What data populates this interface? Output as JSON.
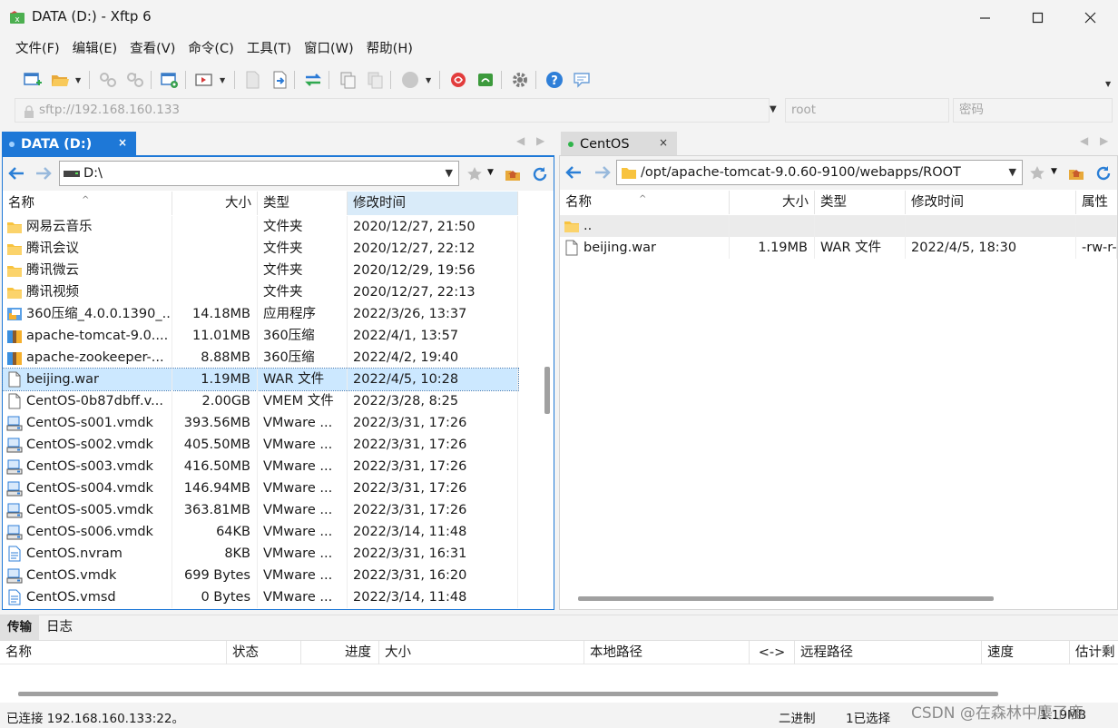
{
  "window": {
    "title": "DATA (D:) - Xftp 6"
  },
  "menu": [
    "文件(F)",
    "编辑(E)",
    "查看(V)",
    "命令(C)",
    "工具(T)",
    "窗口(W)",
    "帮助(H)"
  ],
  "address": {
    "host_placeholder": "sftp://192.168.160.133",
    "user_placeholder": "root",
    "password_placeholder": "密码"
  },
  "colors": {
    "accent": "#1e78d7",
    "local_dot": "#9fd0ff",
    "remote_dot": "#2fb44a",
    "folder": "#f8c33e",
    "selection": "#cce8ff"
  },
  "local": {
    "tab_label": "DATA (D:)",
    "tab_close": "×",
    "path": "D:\\",
    "columns": {
      "name": "名称",
      "size": "大小",
      "type": "类型",
      "modified": "修改时间"
    },
    "files": [
      {
        "name": "网易云音乐",
        "size": "",
        "type": "文件夹",
        "modified": "2020/12/27, 21:50",
        "icon": "folder-icon"
      },
      {
        "name": "腾讯会议",
        "size": "",
        "type": "文件夹",
        "modified": "2020/12/27, 22:12",
        "icon": "folder-icon"
      },
      {
        "name": "腾讯微云",
        "size": "",
        "type": "文件夹",
        "modified": "2020/12/29, 19:56",
        "icon": "folder-icon"
      },
      {
        "name": "腾讯视频",
        "size": "",
        "type": "文件夹",
        "modified": "2020/12/27, 22:13",
        "icon": "folder-icon"
      },
      {
        "name": "360压缩_4.0.0.1390_...",
        "size": "14.18MB",
        "type": "应用程序",
        "modified": "2022/3/26, 13:37",
        "icon": "installer-icon"
      },
      {
        "name": "apache-tomcat-9.0....",
        "size": "11.01MB",
        "type": "360压缩",
        "modified": "2022/4/1, 13:57",
        "icon": "archive-icon"
      },
      {
        "name": "apache-zookeeper-...",
        "size": "8.88MB",
        "type": "360压缩",
        "modified": "2022/4/2, 19:40",
        "icon": "archive-icon"
      },
      {
        "name": "beijing.war",
        "size": "1.19MB",
        "type": "WAR 文件",
        "modified": "2022/4/5, 10:28",
        "icon": "file-icon",
        "selected": true
      },
      {
        "name": "CentOS-0b87dbff.v...",
        "size": "2.00GB",
        "type": "VMEM 文件",
        "modified": "2022/3/28, 8:25",
        "icon": "file-icon"
      },
      {
        "name": "CentOS-s001.vmdk",
        "size": "393.56MB",
        "type": "VMware ...",
        "modified": "2022/3/31, 17:26",
        "icon": "vmdk-icon"
      },
      {
        "name": "CentOS-s002.vmdk",
        "size": "405.50MB",
        "type": "VMware ...",
        "modified": "2022/3/31, 17:26",
        "icon": "vmdk-icon"
      },
      {
        "name": "CentOS-s003.vmdk",
        "size": "416.50MB",
        "type": "VMware ...",
        "modified": "2022/3/31, 17:26",
        "icon": "vmdk-icon"
      },
      {
        "name": "CentOS-s004.vmdk",
        "size": "146.94MB",
        "type": "VMware ...",
        "modified": "2022/3/31, 17:26",
        "icon": "vmdk-icon"
      },
      {
        "name": "CentOS-s005.vmdk",
        "size": "363.81MB",
        "type": "VMware ...",
        "modified": "2022/3/31, 17:26",
        "icon": "vmdk-icon"
      },
      {
        "name": "CentOS-s006.vmdk",
        "size": "64KB",
        "type": "VMware ...",
        "modified": "2022/3/14, 11:48",
        "icon": "vmdk-icon"
      },
      {
        "name": "CentOS.nvram",
        "size": "8KB",
        "type": "VMware ...",
        "modified": "2022/3/31, 16:31",
        "icon": "doc-icon"
      },
      {
        "name": "CentOS.vmdk",
        "size": "699 Bytes",
        "type": "VMware ...",
        "modified": "2022/3/31, 16:20",
        "icon": "vmdk-icon"
      },
      {
        "name": "CentOS.vmsd",
        "size": "0 Bytes",
        "type": "VMware ...",
        "modified": "2022/3/14, 11:48",
        "icon": "doc-icon"
      }
    ]
  },
  "remote": {
    "tab_label": "CentOS",
    "tab_close": "×",
    "path": "/opt/apache-tomcat-9.0.60-9100/webapps/ROOT",
    "columns": {
      "name": "名称",
      "size": "大小",
      "type": "类型",
      "modified": "修改时间",
      "attributes": "属性"
    },
    "files": [
      {
        "name": "..",
        "size": "",
        "type": "",
        "modified": "",
        "attributes": "",
        "icon": "folder-icon",
        "parent": true
      },
      {
        "name": "beijing.war",
        "size": "1.19MB",
        "type": "WAR 文件",
        "modified": "2022/4/5, 18:30",
        "attributes": "-rw-r-",
        "icon": "file-icon"
      }
    ]
  },
  "bottom_tabs": [
    "传输",
    "日志"
  ],
  "transfer_columns": {
    "name": "名称",
    "status": "状态",
    "progress": "进度",
    "size": "大小",
    "local_path": "本地路径",
    "direction": "<->",
    "remote_path": "远程路径",
    "speed": "速度",
    "eta": "估计剩"
  },
  "status": {
    "connected": "已连接 192.168.160.133:22。",
    "mode": "二进制",
    "selected": "1已选择",
    "size": "1.19MB"
  },
  "watermark": "CSDN @在森林中麋了鹿"
}
